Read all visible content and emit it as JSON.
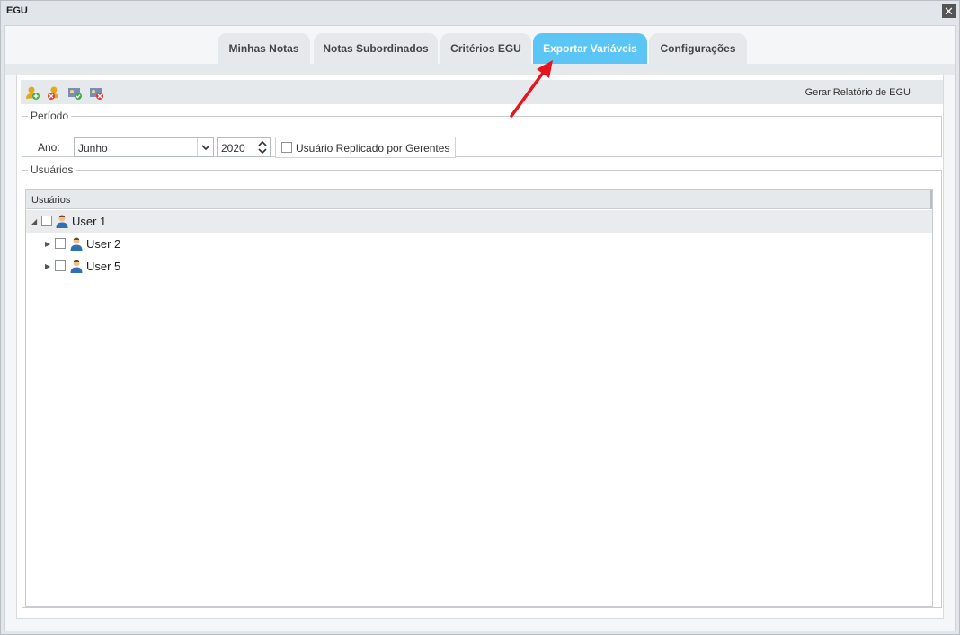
{
  "window": {
    "title": "EGU"
  },
  "tabs": [
    {
      "label": "Minhas Notas",
      "active": false
    },
    {
      "label": "Notas Subordinados",
      "active": false
    },
    {
      "label": "Critérios EGU",
      "active": false
    },
    {
      "label": "Exportar Variáveis",
      "active": true
    },
    {
      "label": "Configurações",
      "active": false
    }
  ],
  "toolbar": {
    "icons": [
      "add-user-icon",
      "remove-user-icon",
      "approve-user-icon",
      "reject-user-icon"
    ],
    "report_label": "Gerar Relatório de EGU"
  },
  "periodo": {
    "legend": "Período",
    "ano_label": "Ano:",
    "month_value": "Junho",
    "year_value": "2020",
    "replicado_label": "Usuário Replicado por Gerentes",
    "replicado_checked": false
  },
  "usuarios": {
    "legend": "Usuários",
    "column_header": "Usuários",
    "rows": [
      {
        "name": "User 1",
        "level": 0,
        "expanded": true,
        "selected": true,
        "checked": false
      },
      {
        "name": "User 2",
        "level": 1,
        "expanded": false,
        "selected": false,
        "checked": false
      },
      {
        "name": "User 5",
        "level": 1,
        "expanded": false,
        "selected": false,
        "checked": false
      }
    ]
  },
  "colors": {
    "active_tab": "#5bc6f6",
    "annotation_arrow": "#e8141c"
  }
}
